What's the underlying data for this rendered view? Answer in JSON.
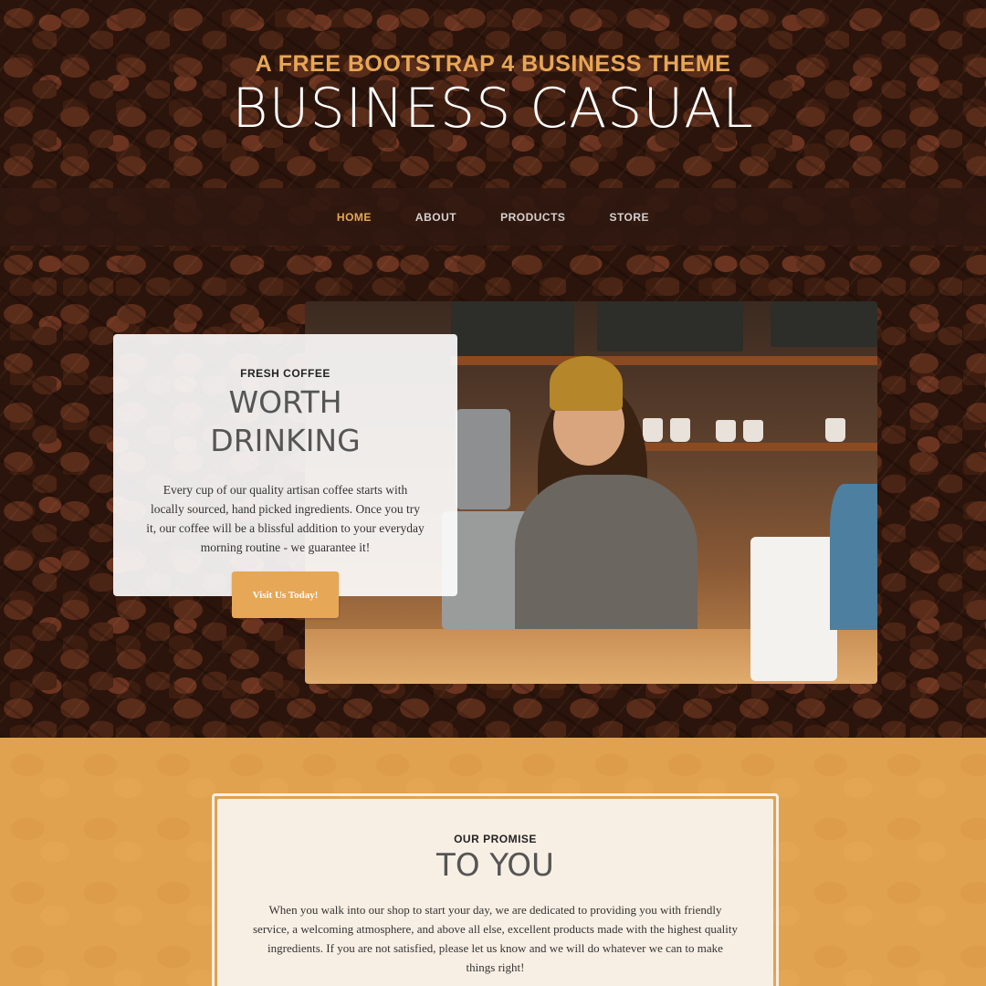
{
  "header": {
    "subtitle": "A Free Bootstrap 4 Business Theme",
    "title": "Business Casual"
  },
  "nav": {
    "items": [
      {
        "label": "Home",
        "active": true
      },
      {
        "label": "About",
        "active": false
      },
      {
        "label": "Products",
        "active": false
      },
      {
        "label": "Store",
        "active": false
      }
    ]
  },
  "intro": {
    "heading_upper": "Fresh Coffee",
    "heading_lower_line1": "Worth",
    "heading_lower_line2": "Drinking",
    "body": "Every cup of our quality artisan coffee starts with locally sourced, hand picked ingredients. Once you try it, our coffee will be a blissful addition to your everyday morning routine - we guarantee it!",
    "button_label": "Visit Us Today!"
  },
  "promise": {
    "heading_upper": "Our Promise",
    "heading_lower": "To You",
    "body": "When you walk into our shop to start your day, we are dedicated to providing you with friendly service, a welcoming atmosphere, and above all else, excellent products made with the highest quality ingredients. If you are not satisfied, please let us know and we will do whatever we can to make things right!"
  },
  "colors": {
    "accent": "#e6a756",
    "nav_background": "#2f170f",
    "promise_background": "#e0a24f"
  }
}
